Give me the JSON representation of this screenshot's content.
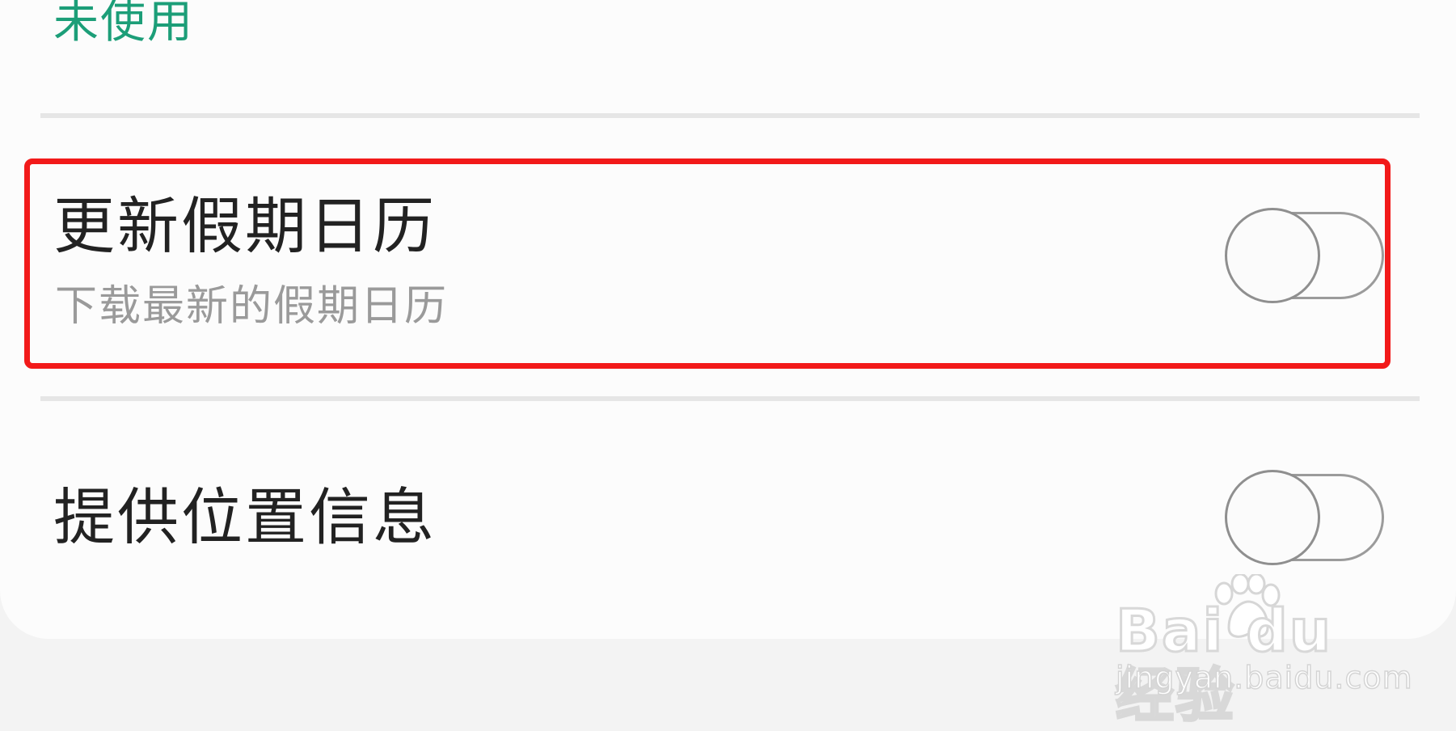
{
  "top_item": {
    "status": "未使用"
  },
  "settings": [
    {
      "title": "更新假期日历",
      "subtitle": "下载最新的假期日历",
      "toggle_state": "off"
    },
    {
      "title": "提供位置信息",
      "toggle_state": "off"
    }
  ],
  "watermark": {
    "brand": "Bai du 经验",
    "url": "jingyan.baidu.com"
  },
  "colors": {
    "status_green": "#1c9e78",
    "highlight_red": "#f21a1a",
    "title_text": "#222222",
    "subtitle_text": "#9a9a9a"
  }
}
